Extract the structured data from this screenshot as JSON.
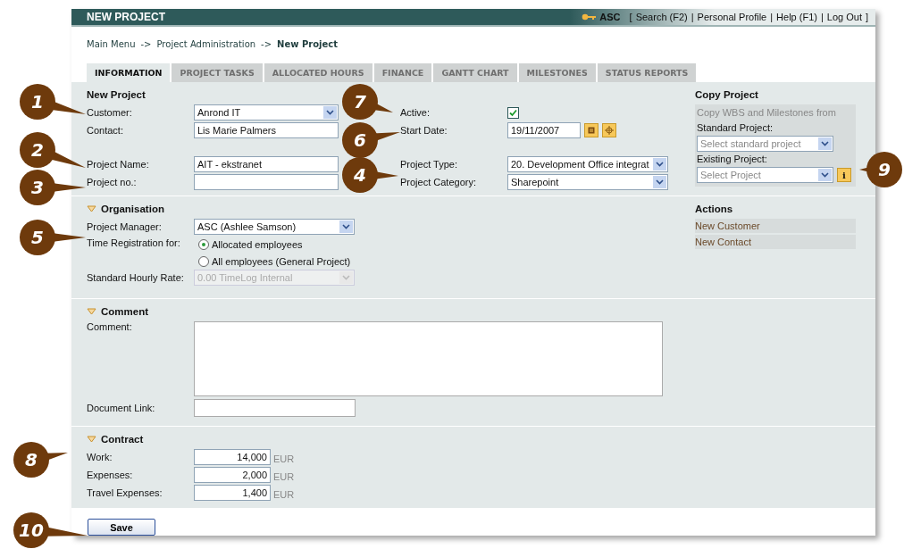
{
  "header": {
    "title": "NEW PROJECT",
    "user": "ASC",
    "open_bracket": "[",
    "close_bracket": "]",
    "separators": [
      "|",
      "|",
      "|"
    ],
    "links": [
      "Search (F2)",
      "Personal Profile",
      "Help (F1)",
      "Log Out"
    ]
  },
  "breadcrumb": [
    {
      "label": "Main Menu",
      "kind": "link"
    },
    {
      "label": "->",
      "kind": "separator"
    },
    {
      "label": "Project Administration",
      "kind": "link"
    },
    {
      "label": "->",
      "kind": "separator"
    },
    {
      "label": "New Project",
      "kind": "current"
    }
  ],
  "tabs": [
    {
      "label": "INFORMATION",
      "selected": true
    },
    {
      "label": "PROJECT TASKS",
      "selected": false
    },
    {
      "label": "ALLOCATED HOURS",
      "selected": false
    },
    {
      "label": "FINANCE",
      "selected": false
    },
    {
      "label": "GANTT CHART",
      "selected": false
    },
    {
      "label": "MILESTONES",
      "selected": false
    },
    {
      "label": "STATUS REPORTS",
      "selected": false
    }
  ],
  "general": {
    "title": "New Project",
    "rows": [
      [
        {
          "label": "Customer:",
          "kind": "select",
          "value": "Anrond IT"
        },
        {
          "label": "Active:",
          "kind": "checkbox",
          "checked": true
        }
      ],
      [
        {
          "label": "Contact:",
          "kind": "text",
          "value": "Lis Marie Palmers"
        },
        {
          "label": "Start Date:",
          "kind": "date",
          "value": "19/11/2007"
        }
      ],
      [
        {
          "label": "Project Name:",
          "kind": "text",
          "value": "AIT - ekstranet"
        },
        {
          "label": "Project Type:",
          "kind": "select",
          "value": "20. Development Office integrat"
        }
      ],
      [
        {
          "label": "Project no.:",
          "kind": "text"
        },
        {
          "label": "Project Category:",
          "kind": "select",
          "value": "Sharepoint"
        }
      ]
    ]
  },
  "copy_project": {
    "title": "Copy Project",
    "note": "Copy WBS and Milestones from",
    "fields": [
      {
        "label": "Standard Project:",
        "placeholder": "Select standard project"
      },
      {
        "label": "Existing Project:",
        "placeholder": "Select Project",
        "info": "i"
      }
    ]
  },
  "organisation": {
    "title": "Organisation",
    "expanded": true,
    "project_manager": {
      "label": "Project Manager:",
      "value": "ASC (Ashlee Samson)"
    },
    "time_registration": {
      "label": "Time Registration for:",
      "options": [
        {
          "label": "Allocated employees",
          "selected": true
        },
        {
          "label": "All employees (General Project)",
          "selected": false
        }
      ]
    },
    "hourly_rate": {
      "label": "Standard Hourly Rate:",
      "value": "0.00 TimeLog Internal",
      "disabled": true
    }
  },
  "actions": {
    "title": "Actions",
    "links": [
      "New Customer",
      "New Contact"
    ]
  },
  "comment": {
    "title": "Comment",
    "expanded": true,
    "comment_label": "Comment:",
    "link_label": "Document Link:"
  },
  "contract": {
    "title": "Contract",
    "expanded": true,
    "fields": [
      {
        "label": "Work:",
        "value": "14,000",
        "currency": "EUR"
      },
      {
        "label": "Expenses:",
        "value": "2,000",
        "currency": "EUR"
      },
      {
        "label": "Travel Expenses:",
        "value": "1,400",
        "currency": "EUR"
      }
    ]
  },
  "save": "Save",
  "callouts": [
    "1",
    "2",
    "3",
    "4",
    "5",
    "7",
    "6",
    "8",
    "9",
    "10"
  ]
}
